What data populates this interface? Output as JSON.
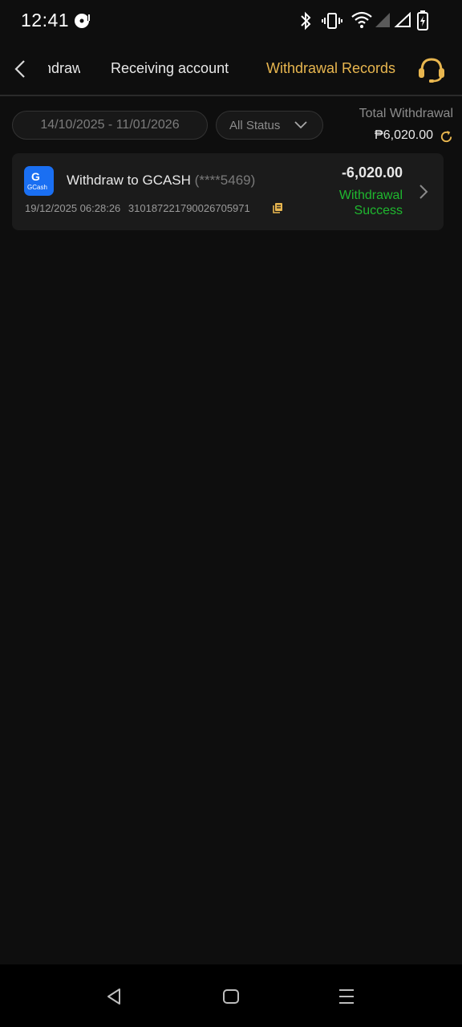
{
  "status_bar": {
    "time": "12:41",
    "icons": [
      "media-icon",
      "bluetooth-icon",
      "vibrate-icon",
      "wifi-icon",
      "cellular-signal-icon",
      "cellular-signal-2-icon",
      "battery-charging-icon"
    ]
  },
  "tabs": {
    "items": [
      {
        "label": "Withdrawal",
        "visible_fragment": "wal"
      },
      {
        "label": "Receiving account"
      },
      {
        "label": "Withdrawal Records",
        "active": true
      }
    ],
    "back_icon": "back-chevron-icon",
    "support_icon": "headset-support-icon"
  },
  "filters": {
    "date_range": "14/10/2025 - 11/01/2026",
    "status": "All Status"
  },
  "summary": {
    "total_label": "Total Withdrawal",
    "total_value": "₱6,020.00"
  },
  "records": [
    {
      "icon": "gcash-logo",
      "logo_letter": "G",
      "logo_text": "GCash",
      "title": "Withdraw to GCASH",
      "masked_account": "(****5469)",
      "datetime": "19/12/2025 06:28:26",
      "transaction_id": "310187221790026705971",
      "amount": "-6,020.00",
      "status": "Withdrawal Success"
    }
  ],
  "colors": {
    "accent": "#e8b64f",
    "success": "#1fb82f",
    "background": "#0e0e0e",
    "card": "#1b1b1b",
    "gcash_blue": "#1a6ff2"
  },
  "nav_bar": [
    "back-triangle-icon",
    "home-square-icon",
    "menu-lines-icon"
  ]
}
